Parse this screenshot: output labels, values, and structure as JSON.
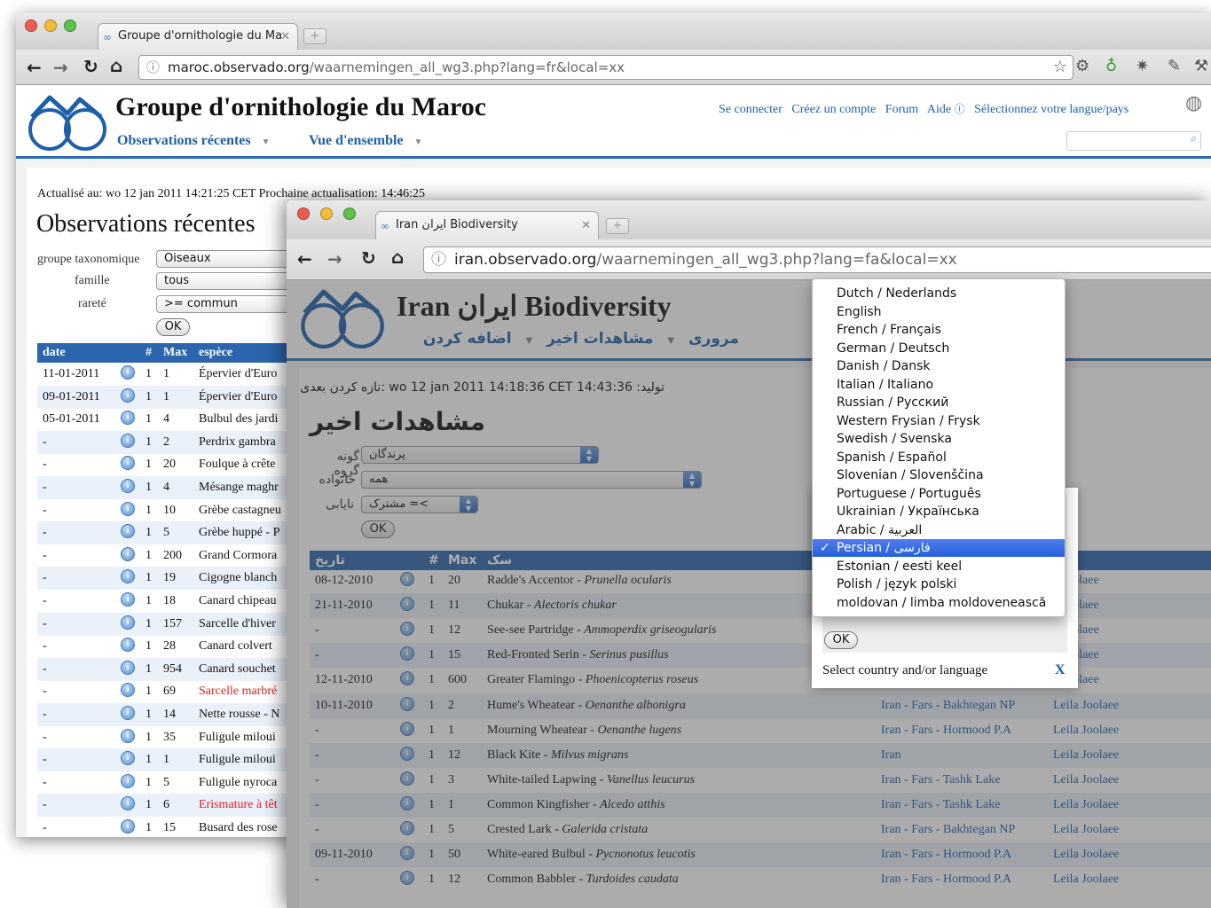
{
  "back_window": {
    "tab_title": "Groupe d'ornithologie du Ma",
    "url_domain": "maroc.observado.org",
    "url_path": "/waarnemingen_all_wg3.php?lang=fr&local=xx",
    "site_title": "Groupe d'ornithologie du Maroc",
    "nav": [
      "Observations récentes",
      "Vue d'ensemble"
    ],
    "top_links": [
      "Se connecter",
      "Créez un compte",
      "Forum",
      "Aide",
      "Sélectionnez votre langue/pays"
    ],
    "update_line": "Actualisé au: wo 12 jan 2011 14:21:25 CET Prochaine actualisation: 14:46:25",
    "page_heading": "Observations récentes",
    "filters": [
      {
        "label": "groupe taxonomique",
        "value": "Oiseaux"
      },
      {
        "label": "famille",
        "value": "tous"
      },
      {
        "label": "rareté",
        "value": ">= commun"
      }
    ],
    "ok_label": "OK",
    "columns": [
      "date",
      "#",
      "Max",
      "espèce"
    ],
    "rows": [
      {
        "date": "11-01-2011",
        "n": "1",
        "max": "1",
        "species": "Épervier d'Euro",
        "rare": false
      },
      {
        "date": "09-01-2011",
        "n": "1",
        "max": "1",
        "species": "Épervier d'Euro",
        "rare": false
      },
      {
        "date": "05-01-2011",
        "n": "1",
        "max": "4",
        "species": "Bulbul des jardi",
        "rare": false
      },
      {
        "date": "-",
        "n": "1",
        "max": "2",
        "species": "Perdrix gambra",
        "rare": false
      },
      {
        "date": "-",
        "n": "1",
        "max": "20",
        "species": "Foulque à crête",
        "rare": false
      },
      {
        "date": "-",
        "n": "1",
        "max": "4",
        "species": "Mésange maghr",
        "rare": false
      },
      {
        "date": "-",
        "n": "1",
        "max": "10",
        "species": "Grèbe castagneu",
        "rare": false
      },
      {
        "date": "-",
        "n": "1",
        "max": "5",
        "species": "Grèbe huppé - P",
        "rare": false
      },
      {
        "date": "-",
        "n": "1",
        "max": "200",
        "species": "Grand Cormora",
        "rare": false
      },
      {
        "date": "-",
        "n": "1",
        "max": "19",
        "species": "Cigogne blanch",
        "rare": false
      },
      {
        "date": "-",
        "n": "1",
        "max": "18",
        "species": "Canard chipeau",
        "rare": false
      },
      {
        "date": "-",
        "n": "1",
        "max": "157",
        "species": "Sarcelle d'hiver",
        "rare": false
      },
      {
        "date": "-",
        "n": "1",
        "max": "28",
        "species": "Canard colvert",
        "rare": false
      },
      {
        "date": "-",
        "n": "1",
        "max": "954",
        "species": "Canard souchet",
        "rare": false
      },
      {
        "date": "-",
        "n": "1",
        "max": "69",
        "species": "Sarcelle marbré",
        "rare": true
      },
      {
        "date": "-",
        "n": "1",
        "max": "14",
        "species": "Nette rousse - N",
        "rare": false
      },
      {
        "date": "-",
        "n": "1",
        "max": "35",
        "species": "Fuligule miloui",
        "rare": false
      },
      {
        "date": "-",
        "n": "1",
        "max": "1",
        "species": "Fuligule miloui",
        "rare": false
      },
      {
        "date": "-",
        "n": "1",
        "max": "5",
        "species": "Fuligule nyroca",
        "rare": false
      },
      {
        "date": "-",
        "n": "1",
        "max": "6",
        "species": "Erismature à têt",
        "rare": true
      },
      {
        "date": "-",
        "n": "1",
        "max": "15",
        "species": "Busard des rose",
        "rare": false
      }
    ]
  },
  "front_window": {
    "tab_title": "Iran ایران Biodiversity",
    "url_domain": "iran.observado.org",
    "url_path": "/waarnemingen_all_wg3.php?lang=fa&local=xx",
    "site_title": "Iran ایران Biodiversity",
    "nav": [
      "مروری",
      "مشاهدات اخیر",
      "اضافه کردن"
    ],
    "update_line": "تولید: wo 12 jan 2011 14:18:36 CET 14:43:36 :تازه کردن بعدی",
    "page_heading": "مشاهدات اخیر",
    "filters": [
      {
        "label": "گونه گروه",
        "value": "پرندگان"
      },
      {
        "label": "خانواده",
        "value": "همه"
      },
      {
        "label": "نایابی",
        "value": ">= مشترک"
      }
    ],
    "ok_label": "OK",
    "columns": [
      "تاریخ",
      "#",
      "Max",
      "سک"
    ],
    "rows": [
      {
        "date": "08-12-2010",
        "n": "1",
        "max": "20",
        "common": "Radde's Accentor",
        "latin": "Prunella ocularis",
        "location": "",
        "observer": "a Joolaee"
      },
      {
        "date": "21-11-2010",
        "n": "1",
        "max": "11",
        "common": "Chukar",
        "latin": "Alectoris chukar",
        "location": "",
        "observer": "a Joolaee"
      },
      {
        "date": "-",
        "n": "1",
        "max": "12",
        "common": "See-see Partridge",
        "latin": "Ammoperdix griseogularis",
        "location": "",
        "observer": "a Joolaee"
      },
      {
        "date": "-",
        "n": "1",
        "max": "15",
        "common": "Red-Fronted Serin",
        "latin": "Serinus pusillus",
        "location": "",
        "observer": "a Joolaee"
      },
      {
        "date": "12-11-2010",
        "n": "1",
        "max": "600",
        "common": "Greater Flamingo",
        "latin": "Phoenicopterus roseus",
        "location": "",
        "observer": "a Joolaee"
      },
      {
        "date": "10-11-2010",
        "n": "1",
        "max": "2",
        "common": "Hume's Wheatear",
        "latin": "Oenanthe albonigra",
        "location": "Iran - Fars - Bakhtegan NP",
        "observer": "Leila Joolaee"
      },
      {
        "date": "-",
        "n": "1",
        "max": "1",
        "common": "Mourning Wheatear",
        "latin": "Oenanthe lugens",
        "location": "Iran - Fars - Hormood P.A",
        "observer": "Leila Joolaee"
      },
      {
        "date": "-",
        "n": "1",
        "max": "12",
        "common": "Black Kite",
        "latin": "Milvus migrans",
        "location": "Iran",
        "observer": "Leila Joolaee"
      },
      {
        "date": "-",
        "n": "1",
        "max": "3",
        "common": "White-tailed Lapwing",
        "latin": "Vanellus leucurus",
        "location": "Iran - Fars - Tashk Lake",
        "observer": "Leila Joolaee"
      },
      {
        "date": "-",
        "n": "1",
        "max": "1",
        "common": "Common Kingfisher",
        "latin": "Alcedo atthis",
        "location": "Iran - Fars - Tashk Lake",
        "observer": "Leila Joolaee"
      },
      {
        "date": "-",
        "n": "1",
        "max": "5",
        "common": "Crested Lark",
        "latin": "Galerida cristata",
        "location": "Iran - Fars - Bakhtegan NP",
        "observer": "Leila Joolaee"
      },
      {
        "date": "09-11-2010",
        "n": "1",
        "max": "50",
        "common": "White-eared Bulbul",
        "latin": "Pycnonotus leucotis",
        "location": "Iran - Fars - Hormood P.A",
        "observer": "Leila Joolaee"
      },
      {
        "date": "-",
        "n": "1",
        "max": "12",
        "common": "Common Babbler",
        "latin": "Turdoides caudata",
        "location": "Iran - Fars - Hormood P.A",
        "observer": "Leila Joolaee"
      }
    ],
    "popup": {
      "ok_label": "OK",
      "caption": "Select country and/or language",
      "close_label": "X"
    },
    "language_menu": {
      "selected_index": 14,
      "check_glyph": "✓",
      "items": [
        "Dutch / Nederlands",
        "English",
        "French / Français",
        "German / Deutsch",
        "Danish / Dansk",
        "Italian / Italiano",
        "Russian / Русский",
        "Western Frysian / Frysk",
        "Swedish / Svenska",
        "Spanish / Español",
        "Slovenian / Slovenščina",
        "Portuguese / Português",
        "Ukrainian / Українська",
        "Arabic / العربية",
        "Persian / فارسی",
        "Estonian / eesti keel",
        "Polish / język polski",
        "moldovan / limba moldovenească"
      ]
    }
  },
  "colors": {
    "accent": "#2a65ad",
    "link": "#1f5fa8",
    "rare": "#e02020",
    "selected": "#2a5ed8"
  }
}
